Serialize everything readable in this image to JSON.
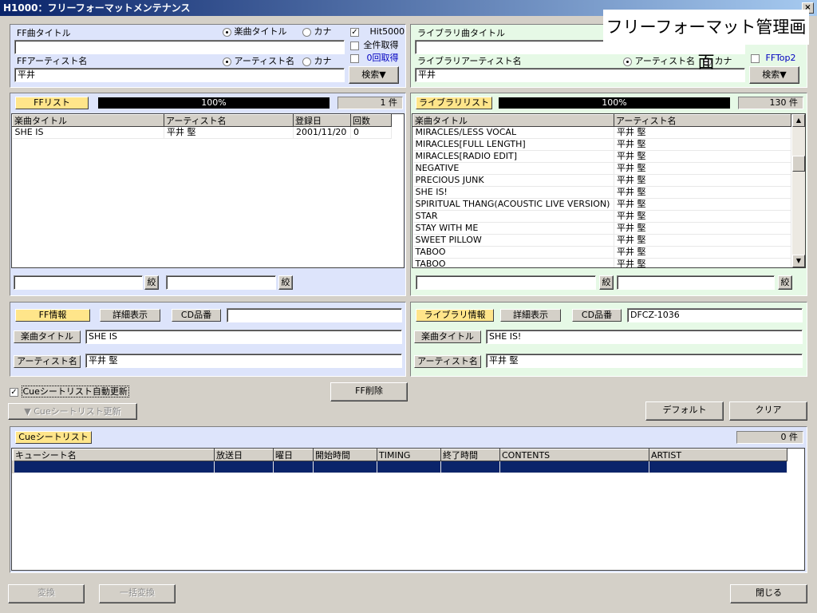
{
  "window": {
    "title": "H1000：フリーフォーマットメンテナンス",
    "close_glyph": "×"
  },
  "overlay_label": "フリーフォーマット管理画面",
  "ff_search": {
    "song_title_label": "FF曲タイトル",
    "song_title_value": "",
    "radio_song_title": "楽曲タイトル",
    "radio_kana": "カナ",
    "artist_label": "FFアーティスト名",
    "artist_value": "平井",
    "radio_artist_name": "アーティスト名",
    "radio_artist_kana": "カナ",
    "hit5000_label": "Hit5000",
    "all_fetch_label": "全件取得",
    "zero_fetch_label": "0回取得",
    "search_button": "検索▼"
  },
  "lib_search": {
    "song_title_label": "ライブラリ曲タイトル",
    "song_title_value": "",
    "artist_label": "ライブラリアーティスト名",
    "artist_value": "平井",
    "radio_artist_name": "アーティスト名",
    "radio_artist_kana": "カナ",
    "fftop2_label": "FFTop2",
    "search_button": "検索▼"
  },
  "ff_list": {
    "label": "FFリスト",
    "progress_text": "100%",
    "progress_value": 1.0,
    "count": "1 件",
    "columns": [
      "楽曲タイトル",
      "アーティスト名",
      "登録日",
      "回数"
    ],
    "rows": [
      [
        "SHE IS",
        "平井 堅",
        "2001/11/20",
        "0"
      ]
    ],
    "filter_button_1": "絞",
    "filter_button_2": "絞"
  },
  "lib_list": {
    "label": "ライブラリリスト",
    "progress_text": "100%",
    "progress_value": 1.0,
    "count": "130 件",
    "columns": [
      "楽曲タイトル",
      "アーティスト名"
    ],
    "rows": [
      [
        "MIRACLES/LESS VOCAL",
        "平井 堅"
      ],
      [
        "MIRACLES[FULL LENGTH]",
        "平井 堅"
      ],
      [
        "MIRACLES[RADIO EDIT]",
        "平井 堅"
      ],
      [
        "NEGATIVE",
        "平井 堅"
      ],
      [
        "PRECIOUS JUNK",
        "平井 堅"
      ],
      [
        "SHE IS!",
        "平井 堅"
      ],
      [
        "SPIRITUAL THANG(ACOUSTIC LIVE VERSION)",
        "平井 堅"
      ],
      [
        "STAR",
        "平井 堅"
      ],
      [
        "STAY WITH ME",
        "平井 堅"
      ],
      [
        "SWEET PILLOW",
        "平井 堅"
      ],
      [
        "TABOO",
        "平井 堅"
      ],
      [
        "TABOO",
        "平井 堅"
      ]
    ],
    "filter_button_1": "絞",
    "filter_button_2": "絞",
    "scroll_up": "▲",
    "scroll_down": "▼"
  },
  "ff_info": {
    "label": "FF情報",
    "detail_button": "詳細表示",
    "cd_label": "CD品番",
    "cd_value": "",
    "song_title_label": "楽曲タイトル",
    "song_title_value": "SHE IS",
    "artist_label": "アーティスト名",
    "artist_value": "平井 堅"
  },
  "lib_info": {
    "label": "ライブラリ情報",
    "detail_button": "詳細表示",
    "cd_label": "CD品番",
    "cd_value": "DFCZ-1036",
    "song_title_label": "楽曲タイトル",
    "song_title_value": "SHE IS!",
    "artist_label": "アーティスト名",
    "artist_value": "平井 堅"
  },
  "controls": {
    "cue_auto_update": "Cueシートリスト自動更新",
    "ff_delete": "FF削除",
    "cue_update_button": "▼ Cueシートリスト更新",
    "default_button": "デフォルト",
    "clear_button": "クリア"
  },
  "cue_list": {
    "label": "Cueシートリスト",
    "count": "0 件",
    "columns": [
      "キューシート名",
      "放送日",
      "曜日",
      "開始時間",
      "TIMING",
      "終了時間",
      "CONTENTS",
      "ARTIST"
    ]
  },
  "footer": {
    "convert_button": "変換",
    "bulk_convert_button": "一括変換",
    "close_button": "閉じる"
  },
  "colors": {
    "title_gradient_start": "#0a246a",
    "ff_panel_bg": "#dde4fb",
    "lib_panel_bg": "#e6f9e6",
    "label_yellow": "#ffe58a",
    "selection_row": "#0a246a"
  }
}
